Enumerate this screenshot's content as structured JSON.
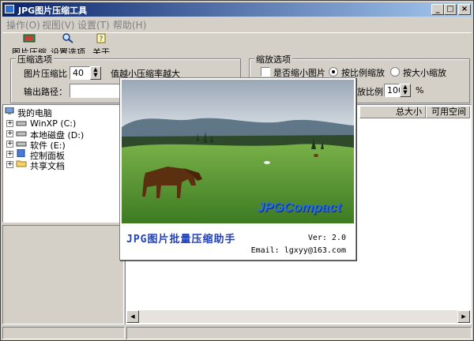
{
  "window": {
    "title": "JPG图片压缩工具",
    "min": "_",
    "max": "□",
    "close": "×"
  },
  "menu": [
    "操作(O)",
    "视图(V)",
    "设置(T)",
    "帮助(H)"
  ],
  "toolbar": [
    "图片压缩",
    "设置选项",
    "关于"
  ],
  "compress": {
    "group_title": "压缩选项",
    "ratio_label": "图片压缩比",
    "ratio_value": "40",
    "hint": "值越小压缩率越大",
    "output_label": "输出路径："
  },
  "scale": {
    "group_title": "缩放选项",
    "shrink_label": "是否缩小图片",
    "proportional_label": "按比例缩放",
    "size_label": "按大小缩放",
    "ratio_label_partial": "放比例",
    "ratio_value": "100",
    "ratio_unit": "%"
  },
  "tree": [
    {
      "label": "我的电脑",
      "icon": "computer-icon"
    },
    {
      "label": "WinXP (C:)",
      "icon": "drive-icon"
    },
    {
      "label": "本地磁盘 (D:)",
      "icon": "drive-icon"
    },
    {
      "label": "软件 (E:)",
      "icon": "drive-icon"
    },
    {
      "label": "控制面板",
      "icon": "control-panel-icon"
    },
    {
      "label": "共享文档",
      "icon": "folder-icon"
    }
  ],
  "columns": [
    "总大小",
    "可用空间"
  ],
  "splash": {
    "brand": "JPGCompact",
    "title": "JPG图片批量压缩助手",
    "version": "Ver: 2.0",
    "email": "Email: lgxyy@163.com"
  },
  "colors": {
    "title_start": "#0a246a",
    "title_end": "#a6caf0",
    "brand": "#2a6fe0",
    "splash_title": "#1f3fbf"
  }
}
